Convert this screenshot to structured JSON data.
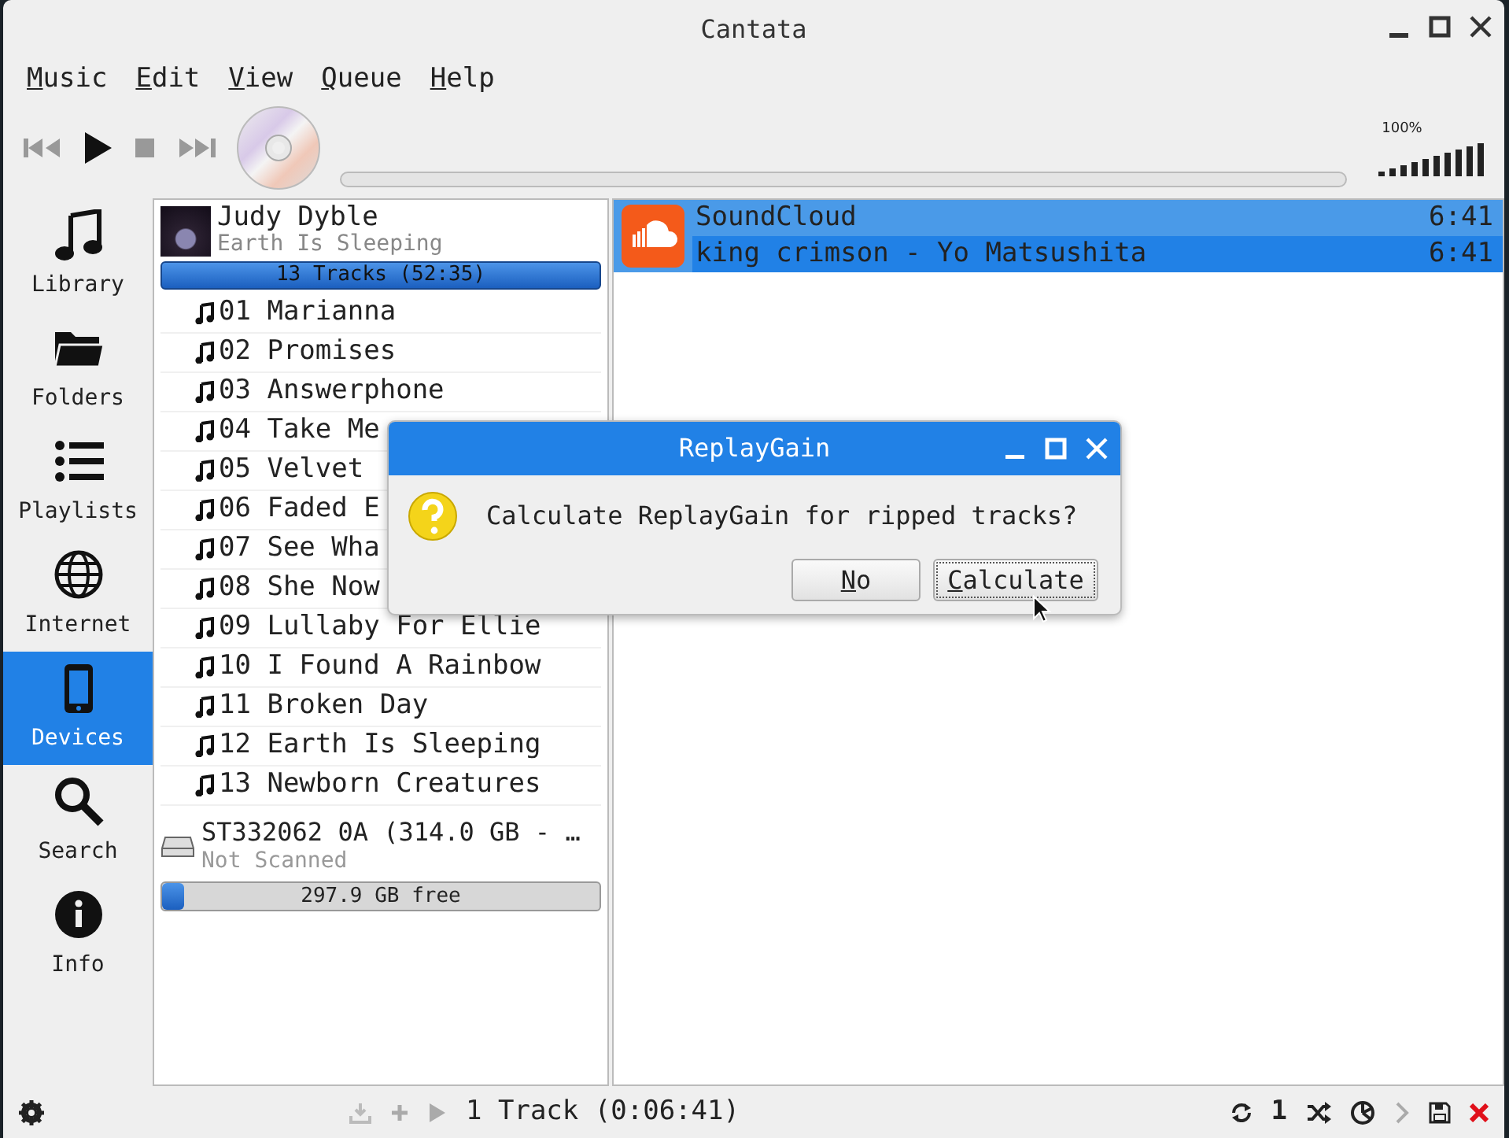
{
  "window": {
    "title": "Cantata"
  },
  "menu": [
    "Music",
    "Edit",
    "View",
    "Queue",
    "Help"
  ],
  "toolbar": {
    "position": {
      "level": 0
    },
    "volume": {
      "reading": "100%",
      "level": 1
    }
  },
  "sidebar": {
    "items": [
      {
        "label": "Library",
        "selected": false
      },
      {
        "label": "Folders",
        "selected": false
      },
      {
        "label": "Playlists",
        "selected": false
      },
      {
        "label": "Internet",
        "selected": false
      },
      {
        "label": "Devices",
        "selected": true
      },
      {
        "label": "Search",
        "selected": false
      },
      {
        "label": "Info",
        "selected": false
      }
    ]
  },
  "devices": {
    "album": {
      "artist": "Judy Dyble",
      "album": "Earth Is Sleeping",
      "summary": "13 Tracks (52:35)"
    },
    "tracks": [
      "01 Marianna",
      "02 Promises",
      "03 Answerphone",
      "04 Take Me",
      "05 Velvet",
      "06 Faded E",
      "07 See Wha",
      "08 She Now",
      "09 Lullaby For Ellie",
      "10 I Found A Rainbow",
      "11 Broken Day",
      "12 Earth Is Sleeping",
      "13 Newborn Creatures"
    ],
    "drive": {
      "name": "ST332062 0A (314.0 GB - …",
      "status": "Not Scanned",
      "free": "297.9 GB free",
      "level": 0.05
    }
  },
  "play_queue": {
    "items": [
      {
        "kind": "header",
        "title": "SoundCloud",
        "duration": "6:41",
        "selected": true
      },
      {
        "kind": "track",
        "title": "king crimson - Yo Matsushita",
        "duration": "6:41",
        "selected": true
      }
    ]
  },
  "status_bar": {
    "summary": "1 Track (0:06:41)",
    "single": "1"
  },
  "dialog": {
    "title": "ReplayGain",
    "message": "Calculate ReplayGain for ripped tracks?",
    "buttons": [
      {
        "label": "No",
        "focused": false
      },
      {
        "label": "Calculate",
        "focused": true
      }
    ]
  }
}
